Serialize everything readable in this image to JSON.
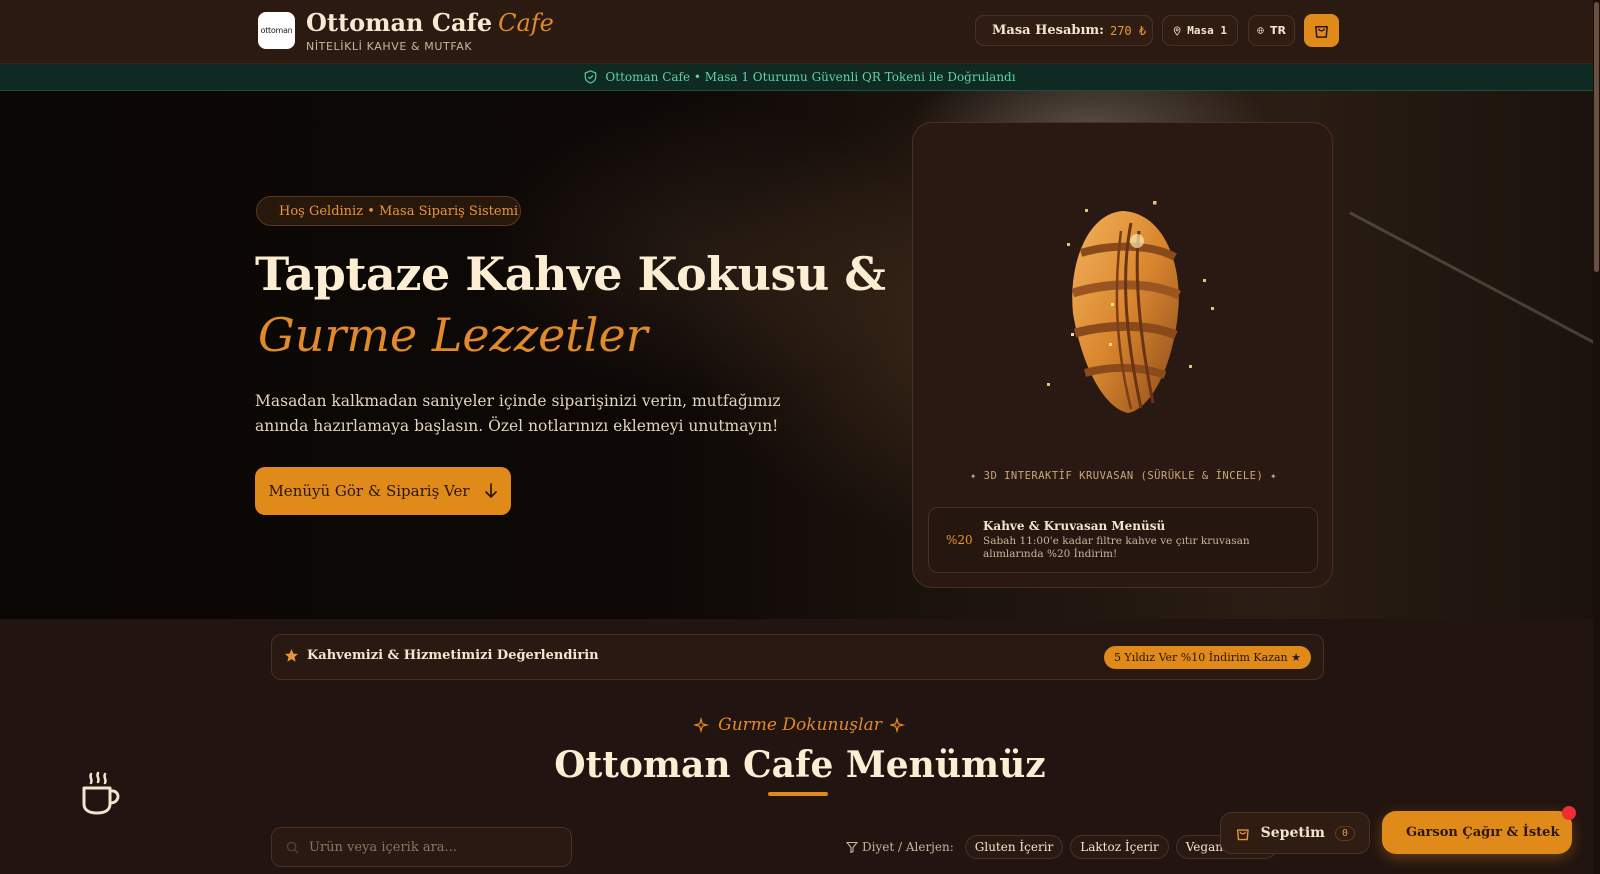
{
  "header": {
    "logo_text": "ottoman",
    "brand_name": "Ottoman Cafe",
    "brand_accent": "Cafe",
    "brand_sub": "NİTELİKLİ KAHVE & MUTFAK",
    "account_label": "Masa Hesabım:",
    "account_value": "270 ₺",
    "table_label": "Masa 1",
    "lang_label": "TR",
    "cart_icon": "shopping-bag-icon"
  },
  "verify_bar": {
    "text": "Ottoman Cafe • Masa 1 Oturumu Güvenli QR Tokeni ile Doğrulandı",
    "icon": "shield-check-icon"
  },
  "hero": {
    "badge": "Hoş Geldiniz • Masa Sipariş Sistemi",
    "title": "Taptaze Kahve Kokusu &",
    "title_script": "Gurme Lezzetler",
    "description": "Masadan kalkmadan saniyeler içinde siparişinizi verin, mutfağımız anında hazırlamaya başlasın. Özel notlarınızı eklemeyi unutmayın!",
    "cta_label": "Menüyü Gör & Sipariş Ver",
    "card_caption": "✦ 3D INTERAKTİF KRUVASAN (SÜRÜKLE & İNCELE) ✦",
    "promo": {
      "percent": "%20",
      "title": "Kahve & Kruvasan Menüsü",
      "desc": "Sabah 11:00'e kadar filtre kahve ve çıtır kruvasan alımlarında %20 İndirim!"
    }
  },
  "rating": {
    "text": "Kahvemizi & Hizmetimizi Değerlendirin",
    "button": "5 Yıldız Ver %10 İndirim Kazan ★"
  },
  "menu": {
    "eyebrow": "Gurme Dokunuşlar",
    "title": "Ottoman Cafe Menümüz",
    "search_placeholder": "Ürün veya içerik ara...",
    "filter_label": "Diyet / Alerjen:",
    "filters": [
      "Gluten İçerir",
      "Laktoz İçerir",
      "Vegan Uygun"
    ]
  },
  "floating": {
    "cart_label": "Sepetim",
    "cart_count": "0",
    "waiter_label": "Garson Çağır & İstek"
  },
  "colors": {
    "accent": "#e08a1a",
    "background": "#221410",
    "verify_green": "#5fd3a4"
  }
}
